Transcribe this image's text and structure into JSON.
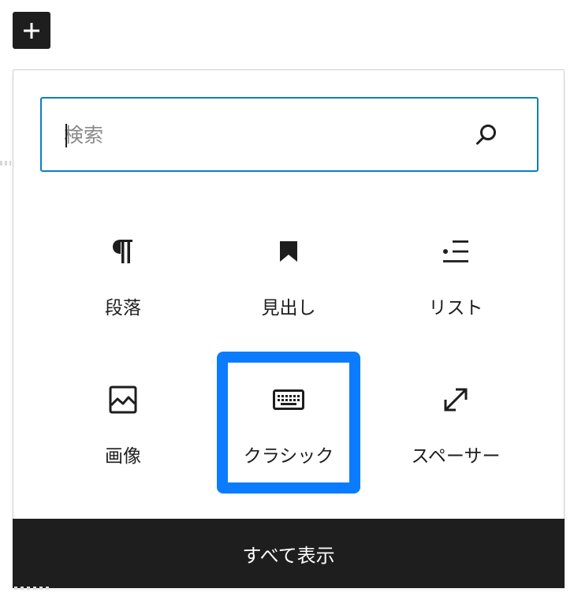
{
  "toolbar": {
    "add_block_icon": "plus-icon"
  },
  "search": {
    "placeholder": "検索",
    "value": "",
    "icon": "search-icon"
  },
  "blocks": [
    {
      "label": "段落",
      "icon": "paragraph-icon"
    },
    {
      "label": "見出し",
      "icon": "heading-bookmark-icon"
    },
    {
      "label": "リスト",
      "icon": "list-icon"
    },
    {
      "label": "画像",
      "icon": "image-icon"
    },
    {
      "label": "クラシック",
      "icon": "keyboard-icon",
      "highlighted": true
    },
    {
      "label": "スペーサー",
      "icon": "resize-arrows-icon"
    }
  ],
  "footer": {
    "browse_all_label": "すべて表示"
  },
  "colors": {
    "accent_focus": "#0a7fc2",
    "highlight": "#0b7cff",
    "dark": "#1e1e1e"
  }
}
